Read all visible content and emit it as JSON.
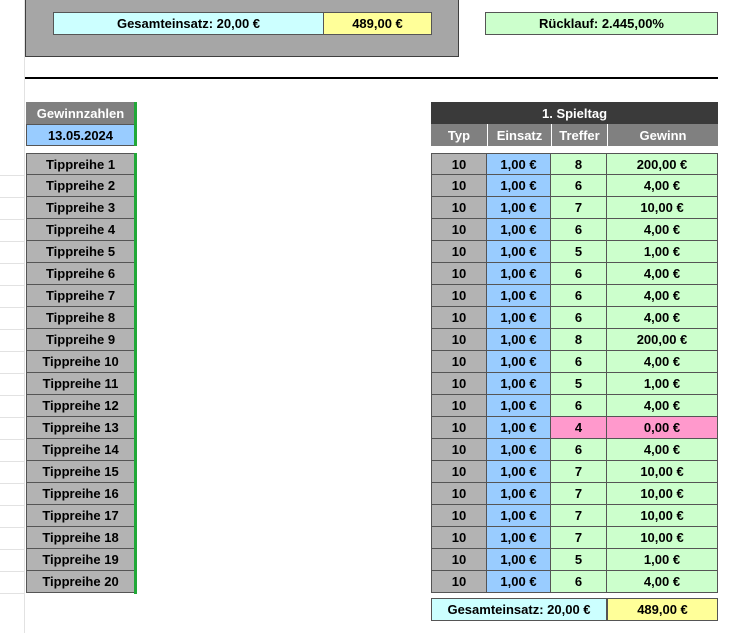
{
  "summary": {
    "gesamteinsatz_label": "Gesamteinsatz: 20,00 €",
    "gesamteinsatz_total": "489,00 €",
    "ruecklauf": "Rücklauf: 2.445,00%"
  },
  "gewinnzahlen": {
    "header": "Gewinnzahlen",
    "date": "13.05.2024"
  },
  "spieltag": {
    "title": "1. Spieltag",
    "columns": [
      "Typ",
      "Einsatz",
      "Treffer",
      "Gewinn"
    ]
  },
  "rows": [
    {
      "label": "Tippreihe 1",
      "typ": "10",
      "einsatz": "1,00 €",
      "treffer": "8",
      "gewinn": "200,00 €"
    },
    {
      "label": "Tippreihe 2",
      "typ": "10",
      "einsatz": "1,00 €",
      "treffer": "6",
      "gewinn": "4,00 €"
    },
    {
      "label": "Tippreihe 3",
      "typ": "10",
      "einsatz": "1,00 €",
      "treffer": "7",
      "gewinn": "10,00 €"
    },
    {
      "label": "Tippreihe 4",
      "typ": "10",
      "einsatz": "1,00 €",
      "treffer": "6",
      "gewinn": "4,00 €"
    },
    {
      "label": "Tippreihe 5",
      "typ": "10",
      "einsatz": "1,00 €",
      "treffer": "5",
      "gewinn": "1,00 €"
    },
    {
      "label": "Tippreihe 6",
      "typ": "10",
      "einsatz": "1,00 €",
      "treffer": "6",
      "gewinn": "4,00 €"
    },
    {
      "label": "Tippreihe 7",
      "typ": "10",
      "einsatz": "1,00 €",
      "treffer": "6",
      "gewinn": "4,00 €"
    },
    {
      "label": "Tippreihe 8",
      "typ": "10",
      "einsatz": "1,00 €",
      "treffer": "6",
      "gewinn": "4,00 €"
    },
    {
      "label": "Tippreihe 9",
      "typ": "10",
      "einsatz": "1,00 €",
      "treffer": "8",
      "gewinn": "200,00 €"
    },
    {
      "label": "Tippreihe 10",
      "typ": "10",
      "einsatz": "1,00 €",
      "treffer": "6",
      "gewinn": "4,00 €"
    },
    {
      "label": "Tippreihe 11",
      "typ": "10",
      "einsatz": "1,00 €",
      "treffer": "5",
      "gewinn": "1,00 €"
    },
    {
      "label": "Tippreihe 12",
      "typ": "10",
      "einsatz": "1,00 €",
      "treffer": "6",
      "gewinn": "4,00 €"
    },
    {
      "label": "Tippreihe 13",
      "typ": "10",
      "einsatz": "1,00 €",
      "treffer": "4",
      "gewinn": "0,00 €",
      "status": "miss"
    },
    {
      "label": "Tippreihe 14",
      "typ": "10",
      "einsatz": "1,00 €",
      "treffer": "6",
      "gewinn": "4,00 €"
    },
    {
      "label": "Tippreihe 15",
      "typ": "10",
      "einsatz": "1,00 €",
      "treffer": "7",
      "gewinn": "10,00 €"
    },
    {
      "label": "Tippreihe 16",
      "typ": "10",
      "einsatz": "1,00 €",
      "treffer": "7",
      "gewinn": "10,00 €"
    },
    {
      "label": "Tippreihe 17",
      "typ": "10",
      "einsatz": "1,00 €",
      "treffer": "7",
      "gewinn": "10,00 €"
    },
    {
      "label": "Tippreihe 18",
      "typ": "10",
      "einsatz": "1,00 €",
      "treffer": "7",
      "gewinn": "10,00 €"
    },
    {
      "label": "Tippreihe 19",
      "typ": "10",
      "einsatz": "1,00 €",
      "treffer": "5",
      "gewinn": "1,00 €"
    },
    {
      "label": "Tippreihe 20",
      "typ": "10",
      "einsatz": "1,00 €",
      "treffer": "6",
      "gewinn": "4,00 €"
    }
  ],
  "footer": {
    "gesamteinsatz_label": "Gesamteinsatz: 20,00 €",
    "gesamteinsatz_total": "489,00 €"
  },
  "colors": {
    "header_dark": "#3a3a3a",
    "header_grey": "#808080",
    "label_grey": "#b3b3b3",
    "einsatz_blue": "#99ccff",
    "win_green": "#ccffcc",
    "loss_pink": "#ff99cc",
    "total_yellow": "#ffff99",
    "label_cyan": "#ccffff",
    "accent_bar": "#21a838"
  }
}
